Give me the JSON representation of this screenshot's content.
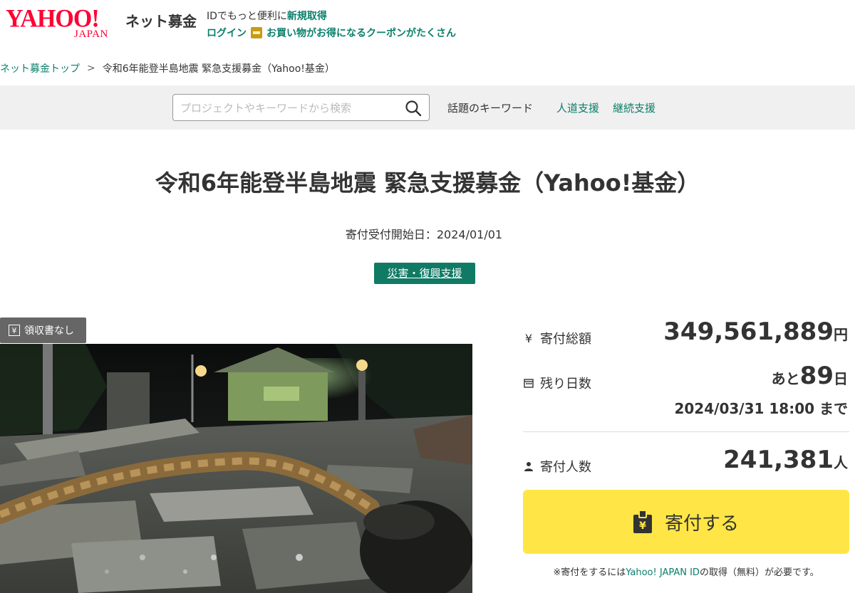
{
  "header": {
    "logo_text": "YAHOO!",
    "logo_sub": "JAPAN",
    "service_name": "ネット募金",
    "id_promo_prefix": "IDでもっと便利に",
    "id_promo_link": "新規取得",
    "login_label": "ログイン",
    "coupon_text": "お買い物がお得になるクーポンがたくさん"
  },
  "breadcrumb": {
    "home": "ネット募金トップ",
    "separator": ">",
    "current": "令和6年能登半島地震 緊急支援募金（Yahoo!基金）"
  },
  "search": {
    "placeholder": "プロジェクトやキーワードから検索",
    "keywords_label": "話題のキーワード",
    "keywords": [
      "人道支援",
      "継続支援"
    ]
  },
  "project": {
    "title": "令和6年能登半島地震 緊急支援募金（Yahoo!基金）",
    "start_date": "寄付受付開始日：2024/01/01",
    "category": "災害・復興支援",
    "receipt_badge": "領収書なし"
  },
  "stats": {
    "total_label": "寄付総額",
    "total_value": "349,561,889",
    "total_unit": "円",
    "days_label": "残り日数",
    "days_prefix": "あと",
    "days_value": "89",
    "days_unit": "日",
    "deadline": "2024/03/31 18:00 まで",
    "donors_label": "寄付人数",
    "donors_value": "241,381",
    "donors_unit": "人"
  },
  "donate": {
    "button_label": "寄付する",
    "note_prefix": "※寄付をするには",
    "note_link": "Yahoo! JAPAN ID",
    "note_suffix": "の取得（無料）が必要です。"
  },
  "colors": {
    "brand_red": "#ff0033",
    "accent_green": "#0a7f6b",
    "category_bg": "#117a65",
    "button_yellow": "#ffe646"
  }
}
